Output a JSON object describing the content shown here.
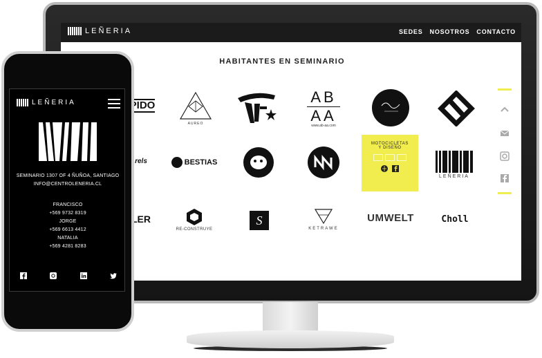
{
  "desktop": {
    "logo_text": "LEÑERIA",
    "nav": [
      {
        "label": "SEDES"
      },
      {
        "label": "NOSOTROS"
      },
      {
        "label": "CONTACTO"
      }
    ],
    "grid_title": "HABITANTES EN SEMINARIO",
    "logos": {
      "pido": "PIDO",
      "aureo": "AUREO",
      "abaa_top": "AB",
      "abaa_bottom": "AA",
      "abaa_url": "www.ab-aa.com",
      "moto_line1": "MOTOCICLETAS",
      "moto_line2": "Y DISEÑO",
      "reels": "rels",
      "bestias": "BESTIAS",
      "leneria": "LEÑERIA",
      "ler": "LER",
      "reconstruye": "RE-CONSTRUYE",
      "ketrawe": "KETRAWE",
      "umwelt": "UMWELT",
      "choll": "Choll"
    },
    "accent_color": "#f2ed4e",
    "side_icons": [
      "chevron-up-icon",
      "mail-icon",
      "instagram-icon",
      "facebook-icon"
    ]
  },
  "mobile": {
    "logo_text": "LEÑERIA",
    "address": "SEMINARIO 1307 OF 4 ÑUÑOA, SANTIAGO",
    "email": "INFO@CENTROLENERIA.CL",
    "contacts": [
      {
        "name": "FRANCISCO",
        "phone": "+569 9732 8319"
      },
      {
        "name": "JORGE",
        "phone": "+569 6613 4412"
      },
      {
        "name": "NATALIA",
        "phone": "+569 4281 8283"
      }
    ],
    "social_icons": [
      "facebook-icon",
      "instagram-icon",
      "linkedin-icon",
      "twitter-icon"
    ]
  }
}
